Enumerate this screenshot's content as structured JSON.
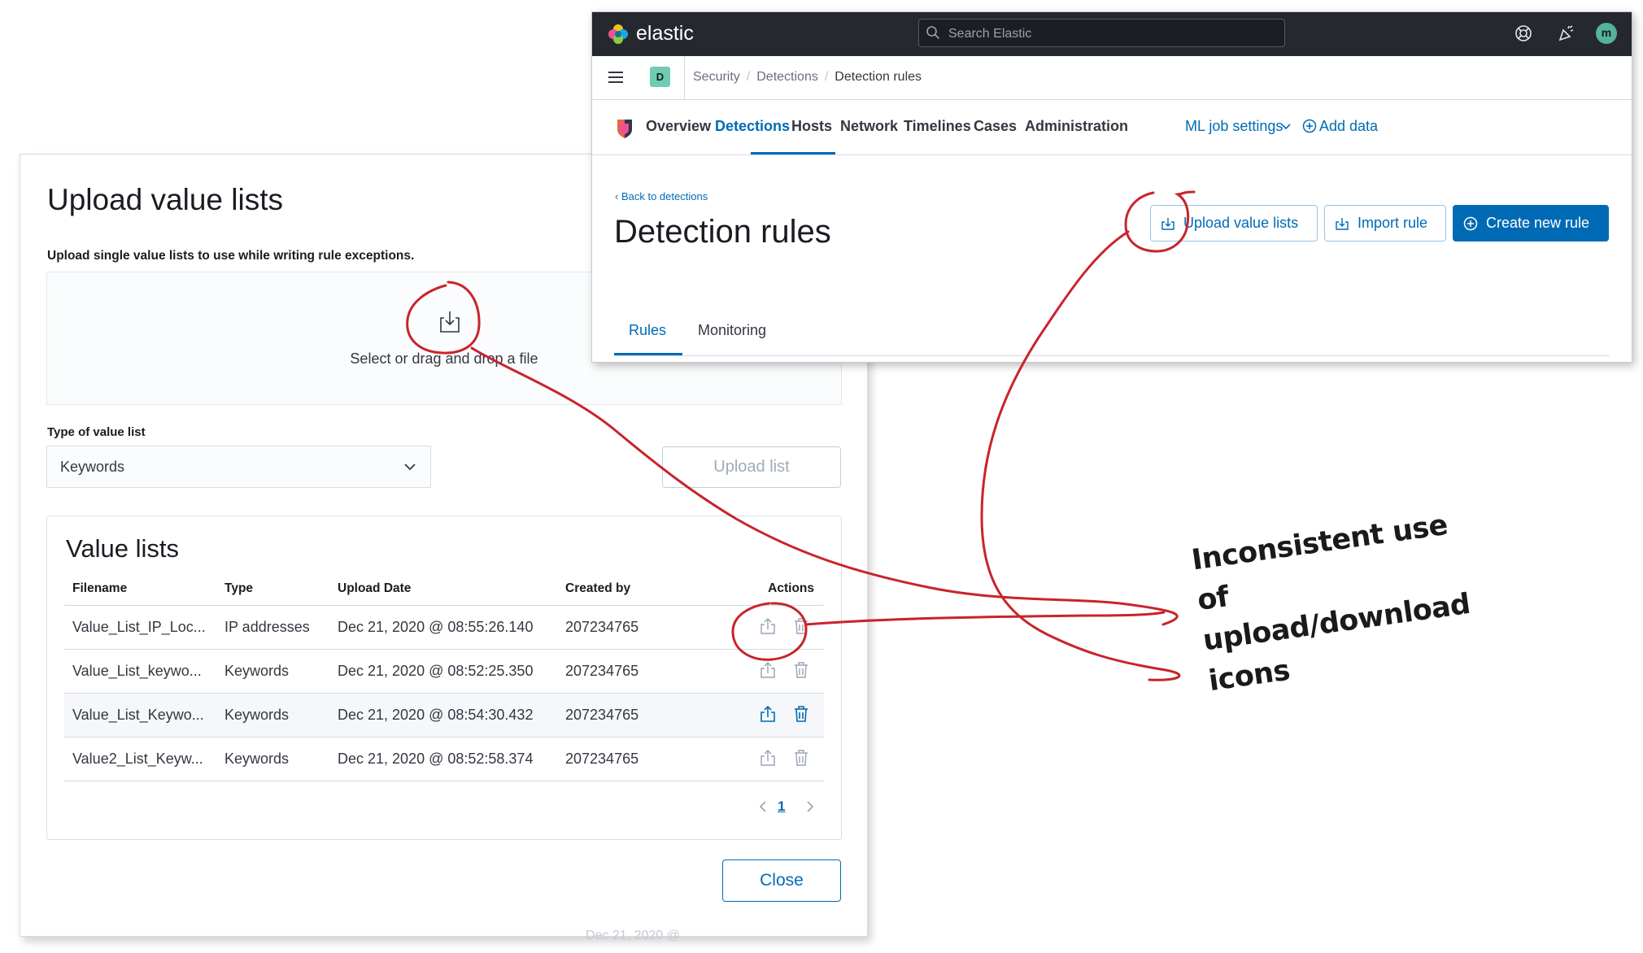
{
  "modal": {
    "title": "Upload value lists",
    "description": "Upload single value lists to use while writing rule exceptions.",
    "dropzone_text": "Select or drag and drop a file",
    "type_label": "Type of value list",
    "type_value": "Keywords",
    "upload_button": "Upload list",
    "lists_title": "Value lists",
    "columns": [
      "Filename",
      "Type",
      "Upload Date",
      "Created by",
      "Actions"
    ],
    "rows": [
      {
        "filename": "Value_List_IP_Loc...",
        "type": "IP addresses",
        "date": "Dec 21, 2020 @ 08:55:26.140",
        "created_by": "207234765"
      },
      {
        "filename": "Value_List_keywo...",
        "type": "Keywords",
        "date": "Dec 21, 2020 @ 08:52:25.350",
        "created_by": "207234765"
      },
      {
        "filename": "Value_List_Keywo...",
        "type": "Keywords",
        "date": "Dec 21, 2020 @ 08:54:30.432",
        "created_by": "207234765"
      },
      {
        "filename": "Value2_List_Keyw...",
        "type": "Keywords",
        "date": "Dec 21, 2020 @ 08:52:58.374",
        "created_by": "207234765"
      }
    ],
    "page": "1",
    "close_button": "Close",
    "ghost_text": "Dec 21, 2020 @"
  },
  "kibana": {
    "brand": "elastic",
    "search_placeholder": "Search Elastic",
    "avatar_initial": "m",
    "space_initial": "D",
    "breadcrumbs": [
      "Security",
      "Detections",
      "Detection rules"
    ],
    "nav": [
      "Overview",
      "Detections",
      "Hosts",
      "Network",
      "Timelines",
      "Cases",
      "Administration"
    ],
    "ml_job_settings": "ML job settings",
    "add_data": "Add data",
    "back_link": "Back to detections",
    "page_title": "Detection rules",
    "buttons": {
      "upload_value_lists": "Upload value lists",
      "import_rule": "Import rule",
      "create_new_rule": "Create new rule"
    },
    "tabs": [
      "Rules",
      "Monitoring"
    ]
  },
  "annotation": {
    "line1": "Inconsistent use of",
    "line2": "upload/download",
    "line3": "icons",
    "color": "#c8242b"
  },
  "colors": {
    "accent": "#006bb4",
    "topbar": "#25282f",
    "avatar": "#54b399",
    "space_badge": "#6dccb1"
  }
}
